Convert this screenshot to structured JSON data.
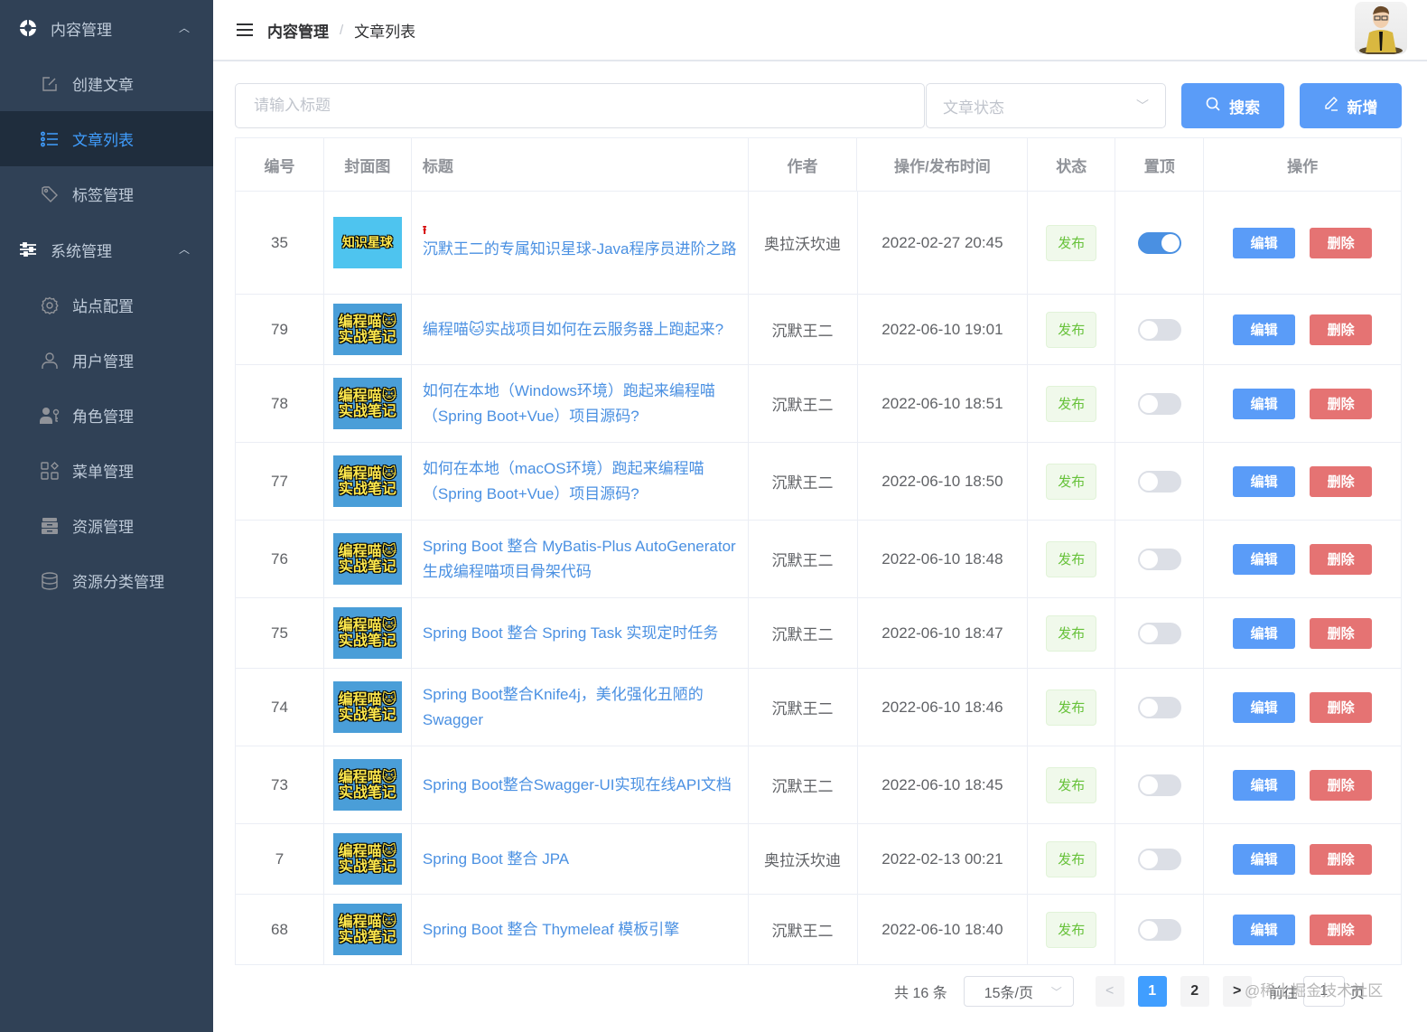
{
  "sidebar": {
    "groups": [
      {
        "label": "内容管理",
        "icon": "content-icon",
        "items": [
          {
            "label": "创建文章",
            "icon": "edit-icon",
            "active": false
          },
          {
            "label": "文章列表",
            "icon": "list-icon",
            "active": true
          },
          {
            "label": "标签管理",
            "icon": "tag-icon",
            "active": false
          }
        ]
      },
      {
        "label": "系统管理",
        "icon": "sliders-icon",
        "items": [
          {
            "label": "站点配置",
            "icon": "gear-icon",
            "active": false
          },
          {
            "label": "用户管理",
            "icon": "user-icon",
            "active": false
          },
          {
            "label": "角色管理",
            "icon": "role-key-icon",
            "active": false
          },
          {
            "label": "菜单管理",
            "icon": "menu-grid-icon",
            "active": false
          },
          {
            "label": "资源管理",
            "icon": "cabinet-icon",
            "active": false
          },
          {
            "label": "资源分类管理",
            "icon": "database-icon",
            "active": false
          }
        ]
      }
    ]
  },
  "header": {
    "breadcrumb": [
      "内容管理",
      "文章列表"
    ],
    "separator": "/"
  },
  "toolbar": {
    "title_placeholder": "请输入标题",
    "title_value": "",
    "status_placeholder": "文章状态",
    "search_label": "搜索",
    "add_label": "新增"
  },
  "table": {
    "columns": [
      "编号",
      "封面图",
      "标题",
      "作者",
      "操作/发布时间",
      "状态",
      "置顶",
      "操作"
    ],
    "edit_label": "编辑",
    "delete_label": "删除",
    "rows": [
      {
        "id": "35",
        "cover_line1": "知识星球",
        "cover_line2": "",
        "pinned_mark": true,
        "title": "沉默王二的专属知识星球-Java程序员进阶之路",
        "author": "奥拉沃坎迪",
        "time": "2022-02-27 20:45",
        "status": "发布",
        "top": true
      },
      {
        "id": "79",
        "cover_line1": "编程喵🐱",
        "cover_line2": "实战笔记",
        "pinned_mark": false,
        "title": "编程喵🐱实战项目如何在云服务器上跑起来?",
        "author": "沉默王二",
        "time": "2022-06-10 19:01",
        "status": "发布",
        "top": false
      },
      {
        "id": "78",
        "cover_line1": "编程喵🐱",
        "cover_line2": "实战笔记",
        "pinned_mark": false,
        "title": "如何在本地（Windows环境）跑起来编程喵（Spring Boot+Vue）项目源码?",
        "author": "沉默王二",
        "time": "2022-06-10 18:51",
        "status": "发布",
        "top": false
      },
      {
        "id": "77",
        "cover_line1": "编程喵🐱",
        "cover_line2": "实战笔记",
        "pinned_mark": false,
        "title": "如何在本地（macOS环境）跑起来编程喵（Spring Boot+Vue）项目源码?",
        "author": "沉默王二",
        "time": "2022-06-10 18:50",
        "status": "发布",
        "top": false
      },
      {
        "id": "76",
        "cover_line1": "编程喵🐱",
        "cover_line2": "实战笔记",
        "pinned_mark": false,
        "title": "Spring Boot 整合 MyBatis-Plus AutoGenerator 生成编程喵项目骨架代码",
        "author": "沉默王二",
        "time": "2022-06-10 18:48",
        "status": "发布",
        "top": false
      },
      {
        "id": "75",
        "cover_line1": "编程喵🐱",
        "cover_line2": "实战笔记",
        "pinned_mark": false,
        "title": "Spring Boot 整合 Spring Task 实现定时任务",
        "author": "沉默王二",
        "time": "2022-06-10 18:47",
        "status": "发布",
        "top": false
      },
      {
        "id": "74",
        "cover_line1": "编程喵🐱",
        "cover_line2": "实战笔记",
        "pinned_mark": false,
        "title": "Spring Boot整合Knife4j，美化强化丑陋的Swagger",
        "author": "沉默王二",
        "time": "2022-06-10 18:46",
        "status": "发布",
        "top": false
      },
      {
        "id": "73",
        "cover_line1": "编程喵🐱",
        "cover_line2": "实战笔记",
        "pinned_mark": false,
        "title": "Spring Boot整合Swagger-UI实现在线API文档",
        "author": "沉默王二",
        "time": "2022-06-10 18:45",
        "status": "发布",
        "top": false
      },
      {
        "id": "7",
        "cover_line1": "编程喵🐱",
        "cover_line2": "实战笔记",
        "pinned_mark": false,
        "title": "Spring Boot 整合 JPA",
        "author": "奥拉沃坎迪",
        "time": "2022-02-13 00:21",
        "status": "发布",
        "top": false
      },
      {
        "id": "68",
        "cover_line1": "编程喵🐱",
        "cover_line2": "实战笔记",
        "pinned_mark": false,
        "title": "Spring Boot 整合 Thymeleaf 模板引擎",
        "author": "沉默王二",
        "time": "2022-06-10 18:40",
        "status": "发布",
        "top": false
      }
    ]
  },
  "pagination": {
    "total_text": "共 16 条",
    "page_size": "15条/页",
    "pages": [
      "1",
      "2"
    ],
    "current": "1",
    "prev": "<",
    "next": ">",
    "goto_label": "前往",
    "goto_value": "1",
    "page_suffix": "页"
  },
  "watermark": "@稀土掘金技术社区",
  "colors": {
    "sidebar_bg": "#304156",
    "sidebar_active_bg": "#1f2d3d",
    "accent": "#409eff",
    "danger": "#e57373",
    "success": "#67c23a"
  }
}
